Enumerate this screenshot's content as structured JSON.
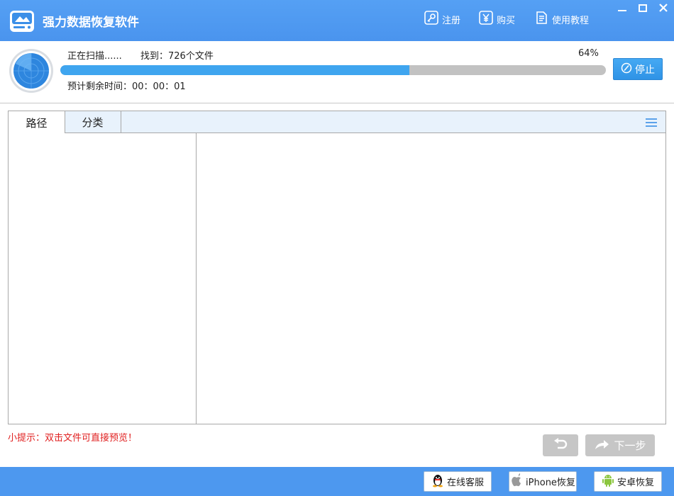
{
  "app": {
    "title": "强力数据恢复软件"
  },
  "header": {
    "register_label": "注册",
    "buy_label": "购买",
    "tutorial_label": "使用教程"
  },
  "scan": {
    "status_text": "正在扫描......",
    "found_text": "找到：726个文件",
    "percent_text": "64%",
    "progress": 0.64,
    "time_text": "预计剩余时间：00：00：01",
    "stop_label": "停止"
  },
  "tabs": [
    {
      "label": "路径",
      "active": true
    },
    {
      "label": "分类",
      "active": false
    }
  ],
  "tip": {
    "text": "小提示：双击文件可直接预览！"
  },
  "nav": {
    "next_label": "下一步"
  },
  "footer": {
    "online_service_label": "在线客服",
    "iphone_recover_label": "iPhone恢复",
    "android_recover_label": "安卓恢复"
  },
  "colors": {
    "brand_blue": "#4d98ef",
    "progress_fill": "#3fa5ef",
    "tip_red": "#e02020",
    "disabled_gray": "#c6c6c6"
  },
  "icons": [
    "app-logo-icon",
    "key-icon",
    "yen-icon",
    "document-icon",
    "minimize-icon",
    "maximize-icon",
    "close-icon",
    "radar-icon",
    "stop-icon",
    "menu-icon",
    "undo-icon",
    "arrow-forward-icon",
    "qq-penguin-icon",
    "apple-icon",
    "android-icon"
  ]
}
